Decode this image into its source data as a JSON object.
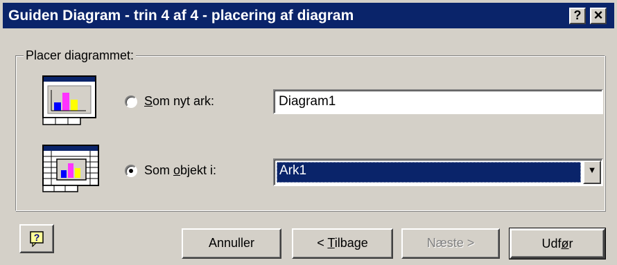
{
  "window": {
    "title": "Guiden Diagram - trin 4 af 4 -  placering af diagram",
    "help_button": "?",
    "close_button": "×"
  },
  "group": {
    "legend": "Placer diagrammet:"
  },
  "options": [
    {
      "label_prefix": "",
      "label_underlined": "S",
      "label_suffix": "om nyt ark:",
      "selected": false,
      "value": "Diagram1",
      "icon": "chart-sheet-icon"
    },
    {
      "label_prefix": "Som ",
      "label_underlined": "o",
      "label_suffix": "bjekt i:",
      "selected": true,
      "value": "Ark1",
      "icon": "embedded-chart-icon"
    }
  ],
  "buttons": {
    "cancel": "Annuller",
    "back_prefix": "< ",
    "back_underlined": "T",
    "back_suffix": "ilbage",
    "next": "Næste >",
    "finish_prefix": "Udf",
    "finish_underlined": "ø",
    "finish_suffix": "r"
  },
  "colors": {
    "titlebar": "#0a246a",
    "face": "#d4d0c8",
    "selection": "#0a246a"
  }
}
